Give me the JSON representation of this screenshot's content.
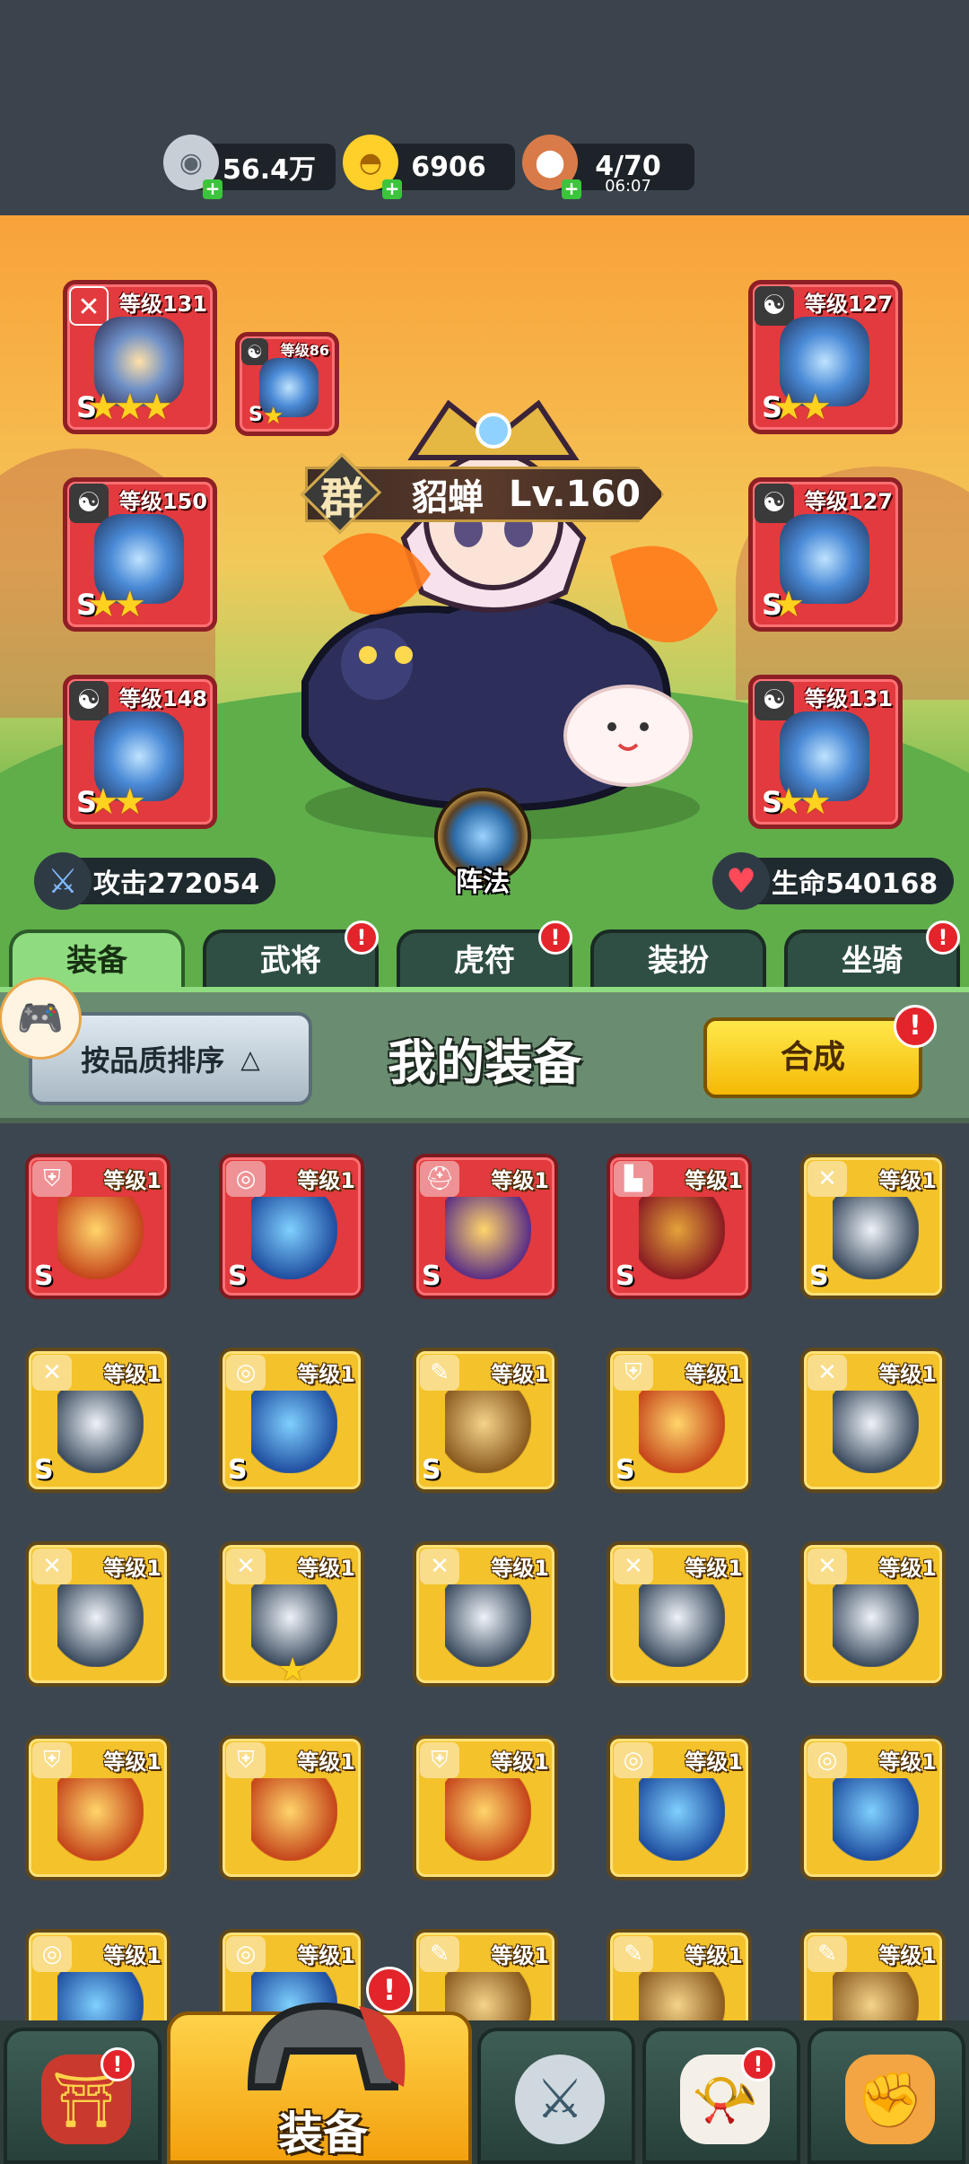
{
  "resources": [
    {
      "value": "56.4万",
      "icon": "silver-coin-icon",
      "color": "#d8dde3"
    },
    {
      "value": "6906",
      "icon": "gold-ingot-icon",
      "color": "#ffd23a"
    },
    {
      "value": "4/70",
      "sub": "06:07",
      "icon": "meat-icon",
      "color": "#c9643a"
    }
  ],
  "hero": {
    "faction": "群",
    "name": "貂蝉",
    "level": "Lv.160"
  },
  "slots": [
    {
      "level": "等级131",
      "grade": "S",
      "stars": "★★★",
      "badge": "sword-icon"
    },
    {
      "level": "等级86",
      "grade": "S",
      "stars": "★",
      "badge": "yinyang-icon"
    },
    {
      "level": "等级150",
      "grade": "S",
      "stars": "★★",
      "badge": "yinyang-icon"
    },
    {
      "level": "等级148",
      "grade": "S",
      "stars": "★★",
      "badge": "yinyang-icon"
    },
    {
      "level": "等级127",
      "grade": "S",
      "stars": "★★",
      "badge": "yinyang-icon"
    },
    {
      "level": "等级127",
      "grade": "S",
      "stars": "★",
      "badge": "yinyang-icon"
    },
    {
      "level": "等级131",
      "grade": "S",
      "stars": "★★",
      "badge": "yinyang-icon"
    }
  ],
  "stats": {
    "attack": "攻击272054",
    "hp": "生命540168"
  },
  "formation": "阵法",
  "tabs": [
    {
      "label": "装备",
      "active": true,
      "dot": false
    },
    {
      "label": "武将",
      "active": false,
      "dot": true
    },
    {
      "label": "虎符",
      "active": false,
      "dot": true
    },
    {
      "label": "装扮",
      "active": false,
      "dot": false
    },
    {
      "label": "坐骑",
      "active": false,
      "dot": true
    }
  ],
  "toolbar": {
    "sort_label": "按品质排序",
    "title": "我的装备",
    "merge_label": "合成"
  },
  "items": [
    {
      "level": "等级1",
      "rarity": "red",
      "grade": "S",
      "icon": "armor-icon"
    },
    {
      "level": "等级1",
      "rarity": "red",
      "grade": "S",
      "icon": "amulet-icon"
    },
    {
      "level": "等级1",
      "rarity": "red",
      "grade": "S",
      "icon": "helmet-icon"
    },
    {
      "level": "等级1",
      "rarity": "red",
      "grade": "S",
      "icon": "boots-icon"
    },
    {
      "level": "等级1",
      "rarity": "gold",
      "grade": "S",
      "icon": "weapon-icon"
    },
    {
      "level": "等级1",
      "rarity": "gold",
      "grade": "S",
      "icon": "weapon-icon"
    },
    {
      "level": "等级1",
      "rarity": "gold",
      "grade": "S",
      "icon": "amulet-icon"
    },
    {
      "level": "等级1",
      "rarity": "gold",
      "grade": "S",
      "icon": "scroll-icon"
    },
    {
      "level": "等级1",
      "rarity": "gold",
      "grade": "S",
      "icon": "armor-icon"
    },
    {
      "level": "等级1",
      "rarity": "gold",
      "grade": "",
      "icon": "weapon-icon"
    },
    {
      "level": "等级1",
      "rarity": "gold",
      "grade": "",
      "icon": "weapon-icon"
    },
    {
      "level": "等级1",
      "rarity": "gold",
      "grade": "",
      "icon": "weapon-icon",
      "star": "★"
    },
    {
      "level": "等级1",
      "rarity": "gold",
      "grade": "",
      "icon": "weapon-icon"
    },
    {
      "level": "等级1",
      "rarity": "gold",
      "grade": "",
      "icon": "weapon-icon"
    },
    {
      "level": "等级1",
      "rarity": "gold",
      "grade": "",
      "icon": "weapon-icon"
    },
    {
      "level": "等级1",
      "rarity": "gold",
      "grade": "",
      "icon": "armor-icon"
    },
    {
      "level": "等级1",
      "rarity": "gold",
      "grade": "",
      "icon": "armor-icon"
    },
    {
      "level": "等级1",
      "rarity": "gold",
      "grade": "",
      "icon": "armor-icon"
    },
    {
      "level": "等级1",
      "rarity": "gold",
      "grade": "",
      "icon": "amulet-icon"
    },
    {
      "level": "等级1",
      "rarity": "gold",
      "grade": "",
      "icon": "amulet-icon"
    },
    {
      "level": "等级1",
      "rarity": "gold",
      "grade": "",
      "icon": "amulet-icon"
    },
    {
      "level": "等级1",
      "rarity": "gold",
      "grade": "",
      "icon": "amulet-icon"
    },
    {
      "level": "等级1",
      "rarity": "gold",
      "grade": "",
      "icon": "scroll-icon"
    },
    {
      "level": "等级1",
      "rarity": "gold",
      "grade": "",
      "icon": "scroll-icon"
    },
    {
      "level": "等级1",
      "rarity": "gold",
      "grade": "",
      "icon": "scroll-icon"
    }
  ],
  "bottom_nav": [
    {
      "name": "city-gate",
      "icon": "city-gate-icon",
      "dot": true
    },
    {
      "name": "equipment",
      "label": "装备",
      "icon": "helmet-icon",
      "dot": true
    },
    {
      "name": "battle",
      "icon": "crossed-swords-icon",
      "dot": false
    },
    {
      "name": "horn",
      "icon": "war-horn-icon",
      "dot": true
    },
    {
      "name": "upgrade",
      "icon": "fist-upgrade-icon",
      "dot": false
    }
  ],
  "dot_mark": "!"
}
